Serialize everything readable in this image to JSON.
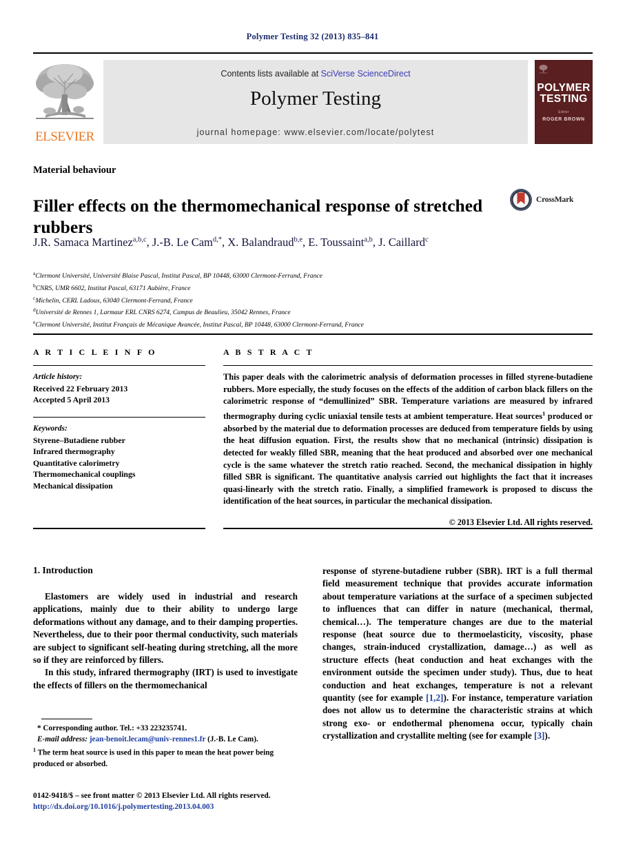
{
  "running_head": "Polymer Testing 32 (2013) 835–841",
  "masthead": {
    "contents_prefix": "Contents lists available at ",
    "contents_link": "SciVerse ScienceDirect",
    "journal_name": "Polymer Testing",
    "homepage": "journal homepage: www.elsevier.com/locate/polytest",
    "publisher_wordmark": "ELSEVIER",
    "cover": {
      "title_line1": "POLYMER",
      "title_line2": "TESTING",
      "editor_label": "Editor",
      "editor_name": "ROGER BROWN"
    }
  },
  "article": {
    "section_label": "Material behaviour",
    "title": "Filler effects on the thermomechanical response of stretched rubbers",
    "crossmark_label": "CrossMark",
    "authors": [
      {
        "name": "J.R. Samaca Martinez",
        "marks": "a,b,c",
        "sep": ", "
      },
      {
        "name": "J.-B. Le Cam",
        "marks": "d,*",
        "sep": ", "
      },
      {
        "name": "X. Balandraud",
        "marks": "b,e",
        "sep": ", "
      },
      {
        "name": "E. Toussaint",
        "marks": "a,b",
        "sep": ", "
      },
      {
        "name": "J. Caillard",
        "marks": "c",
        "sep": ""
      }
    ],
    "affiliations": [
      {
        "mark": "a",
        "text": "Clermont Université, Université Blaise Pascal, Institut Pascal, BP 10448, 63000 Clermont-Ferrand, France"
      },
      {
        "mark": "b",
        "text": "CNRS, UMR 6602, Institut Pascal, 63171 Aubière, France"
      },
      {
        "mark": "c",
        "text": "Michelin, CERL Ladoux, 63040 Clermont-Ferrand, France"
      },
      {
        "mark": "d",
        "text": "Université de Rennes 1, Larmaur ERL CNRS 6274, Campus de Beaulieu, 35042 Rennes, France"
      },
      {
        "mark": "e",
        "text": "Clermont Université, Institut Français de Mécanique Avancée, Institut Pascal, BP 10448, 63000 Clermont-Ferrand, France"
      }
    ]
  },
  "info": {
    "heading": "A R T I C L E   I N F O",
    "history_label": "Article history:",
    "received": "Received 22 February 2013",
    "accepted": "Accepted 5 April 2013",
    "keywords_label": "Keywords:",
    "keywords": [
      "Styrene–Butadiene rubber",
      "Infrared thermography",
      "Quantitative calorimetry",
      "Thermomechanical couplings",
      "Mechanical dissipation"
    ]
  },
  "abstract": {
    "heading": "A B S T R A C T",
    "part1": "This paper deals with the calorimetric analysis of deformation processes in filled styrene-butadiene rubbers. More especially, the study focuses on the effects of the addition of carbon black fillers on the calorimetric response of “demullinized” SBR. Temperature variations are measured by infrared thermography during cyclic uniaxial tensile tests at ambient temperature. Heat sources",
    "footnote_marker": "1",
    "part2": " produced or absorbed by the material due to deformation processes are deduced from temperature fields by using the heat diffusion equation. First, the results show that no mechanical (intrinsic) dissipation is detected for weakly filled SBR, meaning that the heat produced and absorbed over one mechanical cycle is the same whatever the stretch ratio reached. Second, the mechanical dissipation in highly filled SBR is significant. The quantitative analysis carried out highlights the fact that it increases quasi-linearly with the stretch ratio. Finally, a simplified framework is proposed to discuss the identification of the heat sources, in particular the mechanical dissipation.",
    "copyright": "© 2013 Elsevier Ltd. All rights reserved."
  },
  "body": {
    "intro_heading": "1. Introduction",
    "left_para1": "Elastomers are widely used in industrial and research applications, mainly due to their ability to undergo large deformations without any damage, and to their damping properties. Nevertheless, due to their poor thermal conductivity, such materials are subject to significant self-heating during stretching, all the more so if they are reinforced by fillers.",
    "left_para2": "In this study, infrared thermography (IRT) is used to investigate the effects of fillers on the thermomechanical",
    "right_para_a": "response of styrene-butadiene rubber (SBR). IRT is a full thermal field measurement technique that provides accurate information about temperature variations at the surface of a specimen subjected to influences that can differ in nature (mechanical, thermal, chemical…). The temperature changes are due to the material response (heat source due to thermoelasticity, viscosity, phase changes, strain-induced crystallization, damage…) as well as structure effects (heat conduction and heat exchanges with the environment outside the specimen under study). Thus, due to heat conduction and heat exchanges, temperature is not a relevant quantity (see for example ",
    "right_ref_1": "[1,2]",
    "right_para_b": "). For instance, temperature variation does not allow us to determine the characteristic strains at which strong exo- or endothermal phenomena occur, typically chain crystallization and crystallite melting (see for example ",
    "right_ref_2": "[3]",
    "right_para_c": ")."
  },
  "footnotes": {
    "corresponding": "* Corresponding author. Tel.: +33 223235741.",
    "email_label": "E-mail address:",
    "email": "jean-benoit.lecam@univ-rennes1.fr",
    "email_suffix": " (J.-B. Le Cam).",
    "note_marker": "1",
    "note_text": " The term heat source is used in this paper to mean the heat power being produced or absorbed."
  },
  "imprint": {
    "line1": "0142-9418/$ – see front matter © 2013 Elsevier Ltd. All rights reserved.",
    "doi": "http://dx.doi.org/10.1016/j.polymertesting.2013.04.003"
  },
  "colors": {
    "link": "#1f3fa0",
    "running_head": "#1a2a6c",
    "elsevier_orange": "#E87722",
    "cover_maroon": "#5a1f21",
    "contents_box": "#e6e6e6"
  }
}
